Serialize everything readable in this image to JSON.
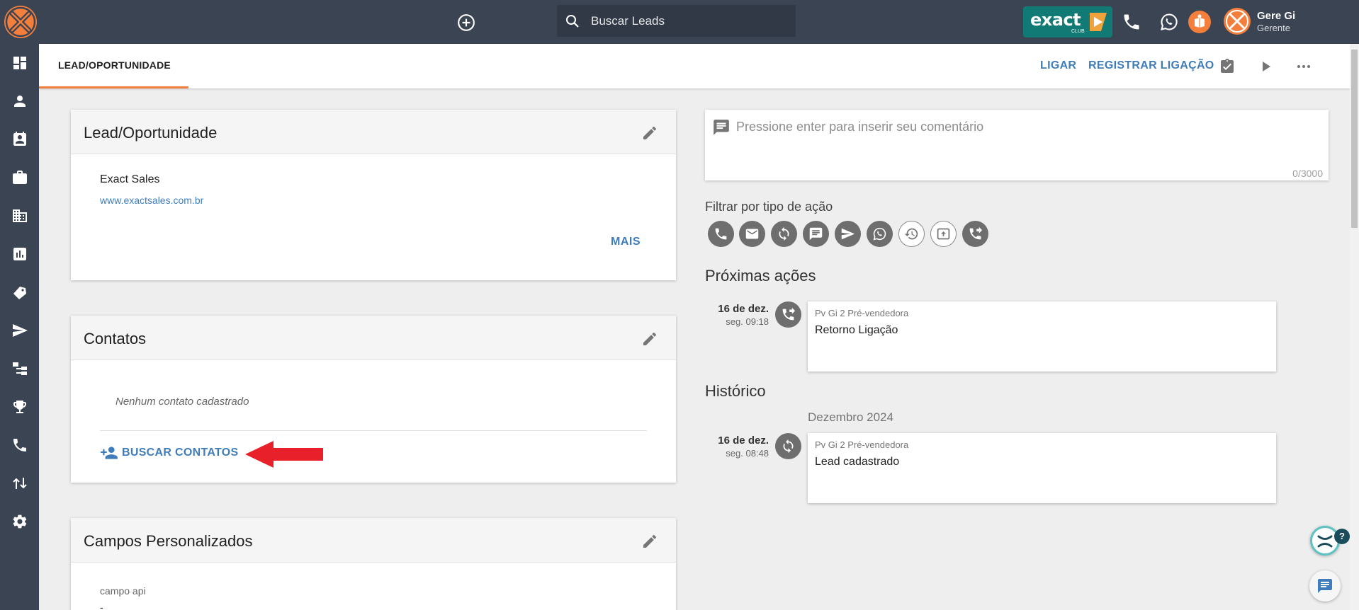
{
  "topbar": {
    "search_placeholder": "Buscar Leads",
    "club_brand": "exact",
    "club_sub": "CLUB",
    "user_name": "Gere Gi",
    "user_role": "Gerente"
  },
  "tabs": {
    "active_tab": "LEAD/OPORTUNIDADE",
    "call_label": "LIGAR",
    "log_call_label": "REGISTRAR LIGAÇÃO"
  },
  "lead_card": {
    "title": "Lead/Oportunidade",
    "company_name": "Exact Sales",
    "company_url": "www.exactsales.com.br",
    "more_label": "MAIS"
  },
  "contacts_card": {
    "title": "Contatos",
    "empty_text": "Nenhum contato cadastrado",
    "find_contacts_label": "BUSCAR CONTATOS"
  },
  "custom_fields_card": {
    "title": "Campos Personalizados",
    "field_label": "campo api",
    "field_value": "-"
  },
  "comment": {
    "placeholder": "Pressione enter para inserir seu comentário",
    "char_count": "0/3000"
  },
  "filter": {
    "label": "Filtrar por tipo de ação",
    "types": [
      {
        "name": "phone-icon"
      },
      {
        "name": "email-icon"
      },
      {
        "name": "sync-icon"
      },
      {
        "name": "message-icon"
      },
      {
        "name": "send-icon"
      },
      {
        "name": "whatsapp-icon"
      },
      {
        "name": "history-icon"
      },
      {
        "name": "upload-icon"
      },
      {
        "name": "phone-forward-icon"
      }
    ]
  },
  "next_actions": {
    "title": "Próximas ações",
    "items": [
      {
        "date": "16 de dez.",
        "time": "seg. 09:18",
        "author": "Pv Gi 2 Pré-vendedora",
        "description": "Retorno Ligação",
        "icon": "phone-forward-icon"
      }
    ]
  },
  "history": {
    "title": "Histórico",
    "month": "Dezembro 2024",
    "items": [
      {
        "date": "16 de dez.",
        "time": "seg. 08:48",
        "author": "Pv Gi 2 Pré-vendedora",
        "description": "Lead cadastrado",
        "icon": "sync-icon"
      }
    ]
  },
  "widgets": {
    "help_badge": "?"
  },
  "colors": {
    "topbar_bg": "#3b4453",
    "accent_orange": "#f47f3c",
    "link_blue": "#3f7dba",
    "club_teal": "#117a74",
    "icon_gray": "#6e6e6e",
    "arrow_red": "#e8202a"
  }
}
